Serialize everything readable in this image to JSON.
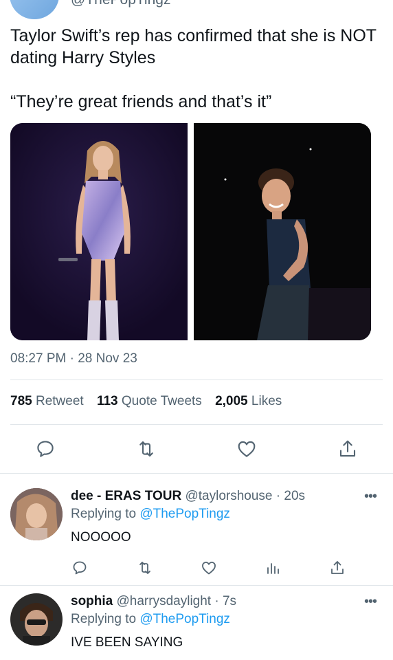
{
  "main_tweet": {
    "handle": "@ThePopTingz",
    "text": "Taylor Swift’s rep has confirmed that she is NOT dating Harry Styles\n\n“They’re great friends and that’s it”",
    "time": "08:27 PM · 28 Nov 23",
    "stats": {
      "retweets_count": "785",
      "retweets_label": "Retweet",
      "quotes_count": "113",
      "quotes_label": "Quote Tweets",
      "likes_count": "2,005",
      "likes_label": "Likes"
    }
  },
  "replies": [
    {
      "name": "dee - ERAS TOUR",
      "handle": "@taylorshouse",
      "time": "· 20s",
      "replying_prefix": "Replying to",
      "replying_to": "@ThePopTingz",
      "text": "NOOOOO",
      "more": "•••"
    },
    {
      "name": "sophia",
      "handle": "@harrysdaylight",
      "time": "· 7s",
      "replying_prefix": "Replying to",
      "replying_to": "@ThePopTingz",
      "text": "IVE BEEN SAYING",
      "more": "•••"
    }
  ],
  "icons": [
    "reply-icon",
    "retweet-icon",
    "like-icon",
    "share-icon",
    "analytics-icon",
    "more-icon"
  ],
  "colors": {
    "text": "#0f1419",
    "muted": "#536471",
    "link": "#1d9bf0",
    "divider": "#e1e6ea"
  }
}
